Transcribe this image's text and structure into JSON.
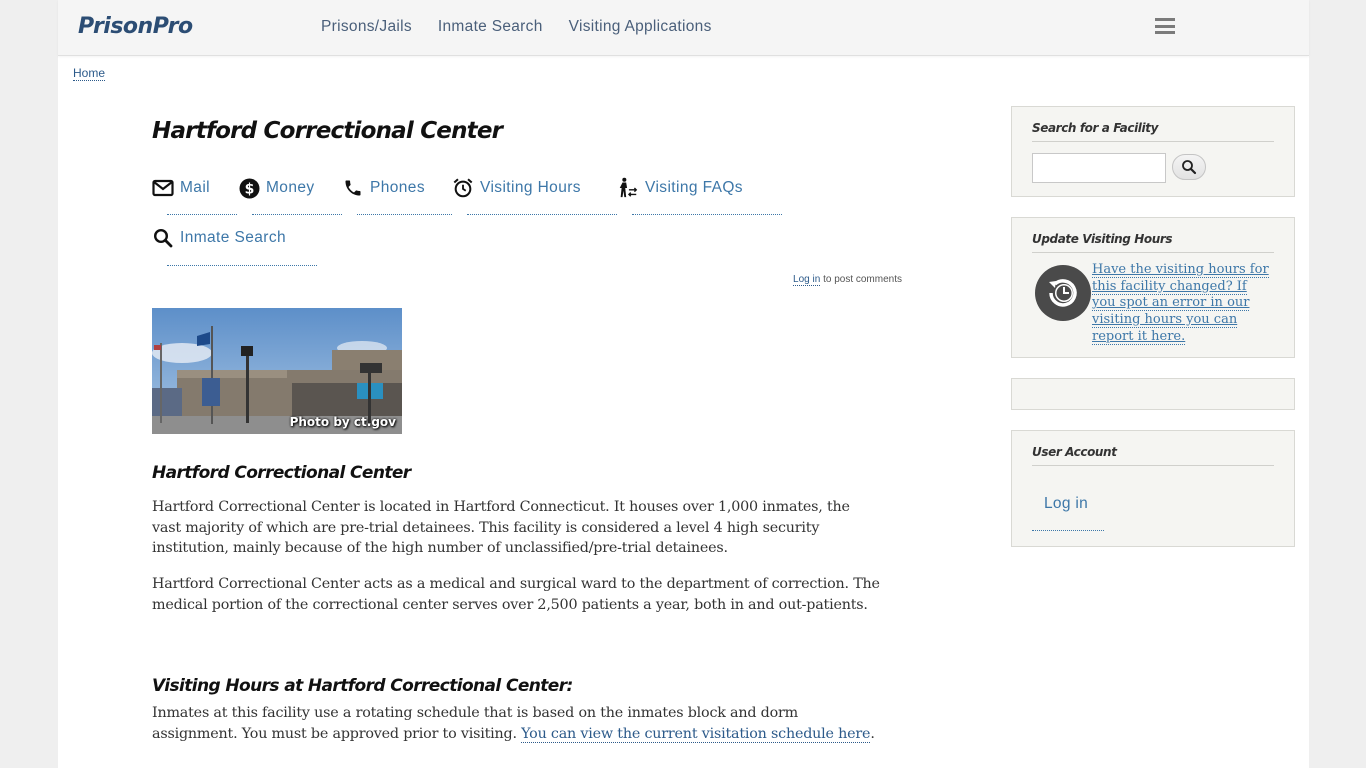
{
  "header": {
    "logo": "PrisonPro",
    "nav": [
      {
        "label": "Prisons/Jails"
      },
      {
        "label": "Inmate Search"
      },
      {
        "label": "Visiting Applications"
      }
    ],
    "menu_icon": "hamburger-icon"
  },
  "breadcrumb": {
    "home": "Home"
  },
  "main": {
    "title": "Hartford Correctional Center",
    "tabs": [
      {
        "label": "Mail",
        "icon": "envelope-icon"
      },
      {
        "label": "Money",
        "icon": "dollar-circle-icon"
      },
      {
        "label": "Phones",
        "icon": "phone-icon"
      },
      {
        "label": "Visiting Hours",
        "icon": "alarm-clock-icon"
      },
      {
        "label": "Visiting FAQs",
        "icon": "person-walking-exchange-icon"
      },
      {
        "label": "Inmate Search",
        "icon": "search-icon"
      }
    ],
    "comment": {
      "login_link": "Log in",
      "suffix": " to post comments"
    },
    "photo_caption": "Photo by ct.gov",
    "section1": {
      "heading": "Hartford Correctional Center",
      "paragraphs": [
        "Hartford Correctional Center is located in Hartford Connecticut.  It houses over 1,000 inmates, the vast majority of which are pre-trial detainees.  This facility is considered a level 4 high security institution, mainly because of the high number of unclassified/pre-trial detainees.",
        "Hartford Correctional Center acts as a medical and surgical ward to the department of correction.  The medical portion of the correctional center serves over 2,500 patients a year, both in and out-patients."
      ]
    },
    "section2": {
      "heading": "Visiting Hours at Hartford Correctional Center:",
      "text": "Inmates at this facility use a rotating schedule that is based on the inmates block and dorm assignment.  You must be approved prior to visiting.  ",
      "link": "You can view the current visitation schedule here",
      "after_link": "."
    }
  },
  "sidebar": {
    "search": {
      "title": "Search for a Facility",
      "input_value": "",
      "placeholder": ""
    },
    "update": {
      "title": "Update Visiting Hours",
      "link": "Have the visiting hours for this facility changed?  If you spot an error in our visiting hours you can report it here."
    },
    "user": {
      "title": "User Account",
      "login": "Log in"
    }
  },
  "colors": {
    "link": "#3d77a8",
    "logo": "#2c4d74",
    "page_bg": "#efefef",
    "block_bg": "#f5f5f2"
  }
}
